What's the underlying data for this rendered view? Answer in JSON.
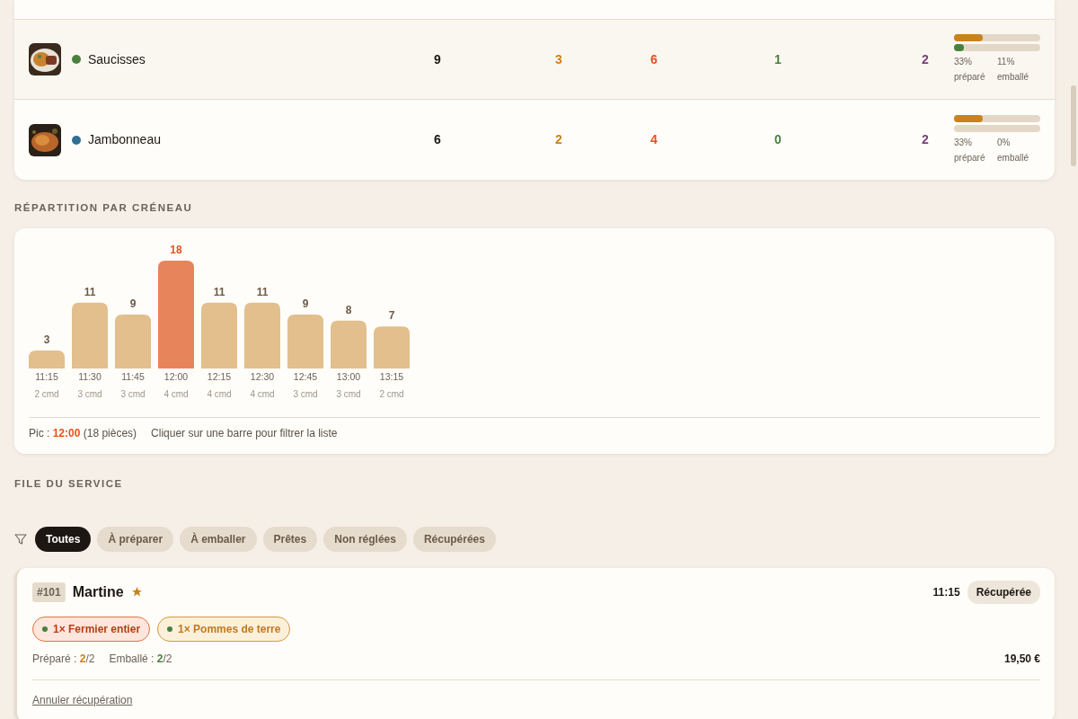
{
  "products": [
    {
      "name": "Saucisses",
      "color": "#4a7f3f",
      "total": "9",
      "to_prepare": "3",
      "to_pack": "6",
      "ready": "1",
      "column_5": "2",
      "prepared": {
        "level": 0.33,
        "percent": "33%",
        "label": "préparé"
      },
      "packed": {
        "level": 0.11,
        "percent": "11%",
        "label": "emballé"
      }
    },
    {
      "name": "Jambonneau",
      "color": "#2f6f94",
      "total": "6",
      "to_prepare": "2",
      "to_pack": "4",
      "ready": "0",
      "column_5": "2",
      "prepared": {
        "level": 0.33,
        "percent": "33%",
        "label": "préparé"
      },
      "packed": {
        "level": 0,
        "percent": "0%",
        "label": "emballé"
      }
    }
  ],
  "slots_section": {
    "title": "RÉPARTITION PAR CRÉNEAU",
    "chart_data": {
      "type": "bar",
      "categories": [
        "11:15",
        "11:30",
        "11:45",
        "12:00",
        "12:15",
        "12:30",
        "12:45",
        "13:00",
        "13:15"
      ],
      "series": [
        {
          "values": [
            3,
            11,
            9,
            18,
            11,
            11,
            9,
            8,
            7
          ]
        }
      ],
      "data_labels": true
    },
    "slots": [
      {
        "orders": "2 cmd",
        "peak": false
      },
      {
        "orders": "3 cmd",
        "peak": false
      },
      {
        "orders": "3 cmd",
        "peak": false
      },
      {
        "orders": "4 cmd",
        "peak": true
      },
      {
        "orders": "4 cmd",
        "peak": false
      },
      {
        "orders": "4 cmd",
        "peak": false
      },
      {
        "orders": "3 cmd",
        "peak": false
      },
      {
        "orders": "3 cmd",
        "peak": false
      },
      {
        "orders": "2 cmd",
        "peak": false
      }
    ],
    "peak": {
      "label": "Pic :",
      "time": "12:00",
      "detail": "(18 pièces)"
    },
    "hint": "Cliquer sur une barre pour filtrer la liste"
  },
  "service_section": {
    "title": "FILE DU SERVICE",
    "filters": [
      {
        "label": "Toutes",
        "selected": true
      },
      {
        "label": "À préparer",
        "selected": false
      },
      {
        "label": "À emballer",
        "selected": false
      },
      {
        "label": "Prêtes",
        "selected": false
      },
      {
        "label": "Non réglées",
        "selected": false
      },
      {
        "label": "Récupérées",
        "selected": false
      }
    ],
    "orders": [
      {
        "number": "#101",
        "customer": "Martine",
        "favorite": true,
        "time": "11:15",
        "status": "Récupérée",
        "items": [
          {
            "text": "1× Fermier entier",
            "kind": "chicken",
            "color": "#4a7f3f"
          },
          {
            "text": "1× Pommes de terre",
            "kind": "side",
            "color": "#4a7f3f"
          }
        ],
        "prepared": {
          "label": "Préparé :",
          "done": "2",
          "total": "/2"
        },
        "packed": {
          "label": "Emballé :",
          "done": "2",
          "total": "/2"
        },
        "price": "19,50 €",
        "action": "Annuler récupération"
      }
    ]
  }
}
